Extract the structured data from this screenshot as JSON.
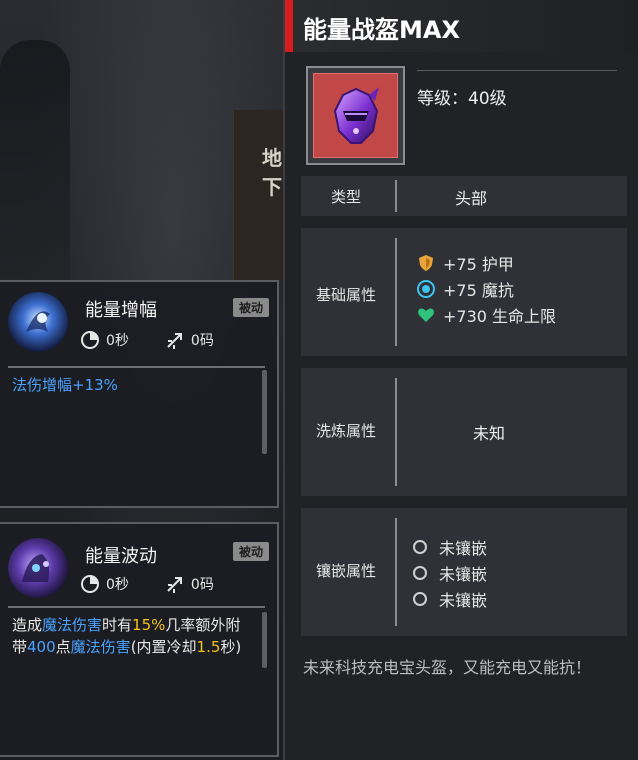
{
  "background": {
    "book_title": "地下"
  },
  "skills": [
    {
      "name": "能量增幅",
      "badge": "被动",
      "cooldown": "0秒",
      "range": "0码",
      "icon": "energy-amplify-icon",
      "description": [
        {
          "text": "法伤增幅+13%",
          "color": "blue"
        }
      ]
    },
    {
      "name": "能量波动",
      "badge": "被动",
      "cooldown": "0秒",
      "range": "0码",
      "icon": "energy-wave-icon",
      "description": [
        {
          "text": "造成",
          "color": "white"
        },
        {
          "text": "魔法伤害",
          "color": "blue"
        },
        {
          "text": "时有",
          "color": "white"
        },
        {
          "text": "15%",
          "color": "gold"
        },
        {
          "text": "几率额外附带",
          "color": "white"
        },
        {
          "text": "400",
          "color": "blue"
        },
        {
          "text": "点",
          "color": "white"
        },
        {
          "text": "魔法伤害",
          "color": "blue"
        },
        {
          "text": "(内置冷却",
          "color": "white"
        },
        {
          "text": "1.5",
          "color": "gold"
        },
        {
          "text": "秒)",
          "color": "white"
        }
      ]
    }
  ],
  "item": {
    "title": "能量战盔MAX",
    "level": "等级：40级",
    "icon": "energy-helmet-icon",
    "type_label": "类型",
    "type_value": "头部",
    "base_label": "基础属性",
    "base_props": [
      {
        "icon": "armor-shield-icon",
        "text": "+75 护甲",
        "color": "#e8a53a"
      },
      {
        "icon": "magic-resist-icon",
        "text": "+75 魔抗",
        "color": "#3cc4f0"
      },
      {
        "icon": "health-heart-icon",
        "text": "+730 生命上限",
        "color": "#2ec27e"
      }
    ],
    "refine_label": "洗炼属性",
    "refine_value": "未知",
    "socket_label": "镶嵌属性",
    "sockets": [
      "未镶嵌",
      "未镶嵌",
      "未镶嵌"
    ],
    "description": "未来科技充电宝头盔，又能充电又能抗！"
  },
  "colors": {
    "accent_red": "#d61c1c",
    "text_blue": "#4aa2ff",
    "text_gold": "#f2c21a"
  }
}
